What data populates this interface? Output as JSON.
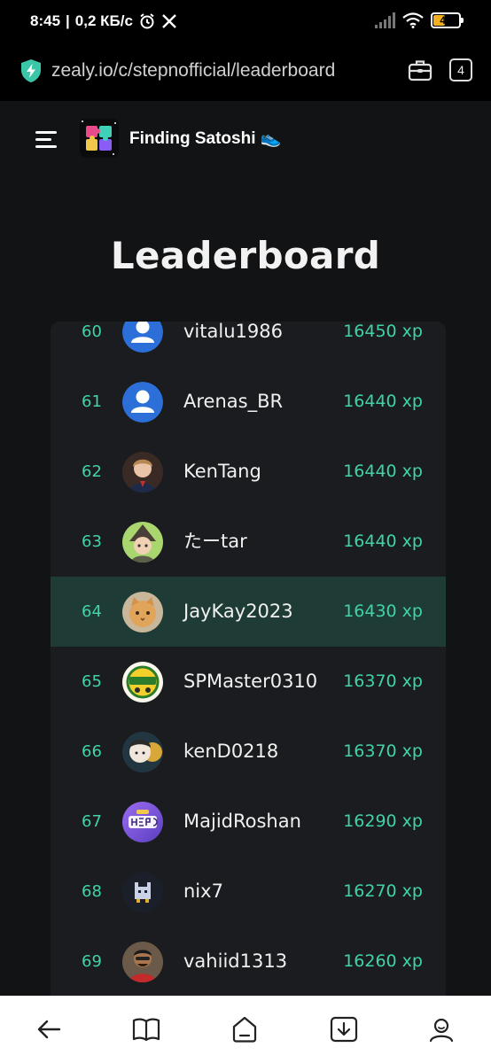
{
  "status_bar": {
    "time": "8:45",
    "network_speed": "0,2 КБ/с",
    "battery": "46",
    "battery_level": 0.46,
    "icons": [
      "alarm-icon",
      "x-app-icon",
      "signal-icon",
      "wifi-icon",
      "battery-icon"
    ]
  },
  "browser": {
    "url": "zealy.io/c/stepnofficial/leaderboard",
    "tabs_count": "4",
    "icons": [
      "shield-bolt-icon",
      "briefcase-icon"
    ]
  },
  "header": {
    "community_name": "Finding Satoshi 👟",
    "icons": [
      "hamburger-menu-icon",
      "community-logo"
    ]
  },
  "page": {
    "title": "Leaderboard"
  },
  "leaderboard": [
    {
      "rank": "60",
      "name": "vitalu1986",
      "xp": "16450 xp",
      "avatar": "default-user-icon"
    },
    {
      "rank": "61",
      "name": "Arenas_BR",
      "xp": "16440 xp",
      "avatar": "default-user-icon"
    },
    {
      "rank": "62",
      "name": "KenTang",
      "xp": "16440 xp",
      "avatar": "photo-avatar"
    },
    {
      "rank": "63",
      "name": "たーtar",
      "xp": "16440 xp",
      "avatar": "photo-avatar"
    },
    {
      "rank": "64",
      "name": "JayKay2023",
      "xp": "16430 xp",
      "avatar": "cat-photo-avatar",
      "current_user": true
    },
    {
      "rank": "65",
      "name": "SPMaster0310",
      "xp": "16370 xp",
      "avatar": "badge-avatar"
    },
    {
      "rank": "66",
      "name": "kenD0218",
      "xp": "16370 xp",
      "avatar": "cartoon-avatar"
    },
    {
      "rank": "67",
      "name": "MajidRoshan",
      "xp": "16290 xp",
      "avatar": "hero-logo-avatar"
    },
    {
      "rank": "68",
      "name": "nix7",
      "xp": "16270 xp",
      "avatar": "pixel-cat-avatar"
    },
    {
      "rank": "69",
      "name": "vahiid1313",
      "xp": "16260 xp",
      "avatar": "photo-avatar"
    }
  ],
  "colors": {
    "accent": "#41d3a6",
    "page_background": "#121315",
    "card_background": "#1a1c1f",
    "highlight_row": "#1f3b36"
  },
  "bottom_nav": {
    "icons": [
      "back-arrow-icon",
      "bookmarks-icon",
      "home-icon",
      "downloads-icon",
      "profile-icon"
    ]
  }
}
